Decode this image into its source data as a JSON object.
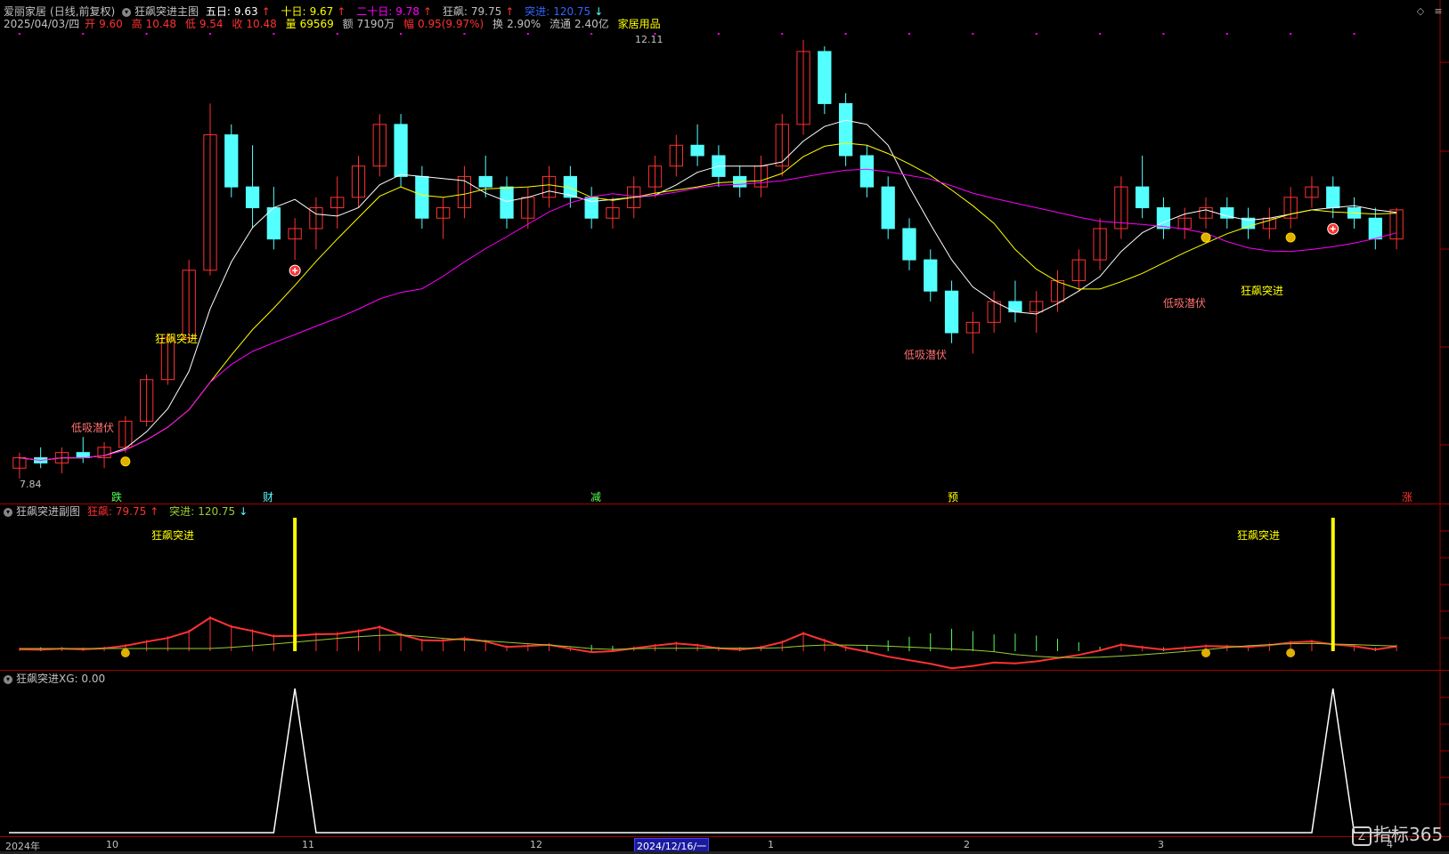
{
  "stock": {
    "name": "爱丽家居",
    "period": "(日线,前复权)",
    "indicator": "狂飙突进主图",
    "date": "2025/04/03/四",
    "open_label": "开",
    "open": "9.60",
    "high_label": "高",
    "high": "10.48",
    "low_label": "低",
    "low": "9.54",
    "close_label": "收",
    "close": "10.48",
    "vol_label": "量",
    "vol": "69569",
    "amt_label": "额",
    "amt": "7190万",
    "chg_label": "幅",
    "chg": "0.95(9.97%)",
    "turn_label": "换",
    "turn": "2.90%",
    "float_label": "流通",
    "float": "2.40亿",
    "sector": "家居用品"
  },
  "ma": {
    "ma5_label": "五日:",
    "ma5": "9.63",
    "ma10_label": "十日:",
    "ma10": "9.67",
    "ma20_label": "二十日:",
    "ma20": "9.78",
    "kb_label": "狂飙:",
    "kb": "79.75",
    "tj_label": "突进:",
    "tj": "120.75",
    "up_arrow": "↑",
    "down_arrow": "↓"
  },
  "colors": {
    "up": "#ff3232",
    "down": "#54ffff",
    "ma5": "#ffffff",
    "ma10": "#ffff00",
    "ma20": "#ff00ff",
    "grid": "#a00000",
    "signal": "#ffff00"
  },
  "annotations": {
    "high_price": "12.11",
    "low_price": "7.84",
    "signal1": "狂飙突进",
    "signal2": "狂飙突进",
    "dip1": "低吸潜伏",
    "dip2": "低吸潜伏",
    "dip3": "低吸潜伏"
  },
  "event_marks": [
    {
      "label": "跌",
      "color": "#54ff54"
    },
    {
      "label": "财",
      "color": "#54ffff"
    },
    {
      "label": "减",
      "color": "#54ff54"
    },
    {
      "label": "预",
      "color": "#ffff00"
    },
    {
      "label": "涨",
      "color": "#ff3232"
    }
  ],
  "sub1": {
    "title": "狂飙突进副图",
    "kb_label": "狂飙:",
    "kb": "79.75",
    "tj_label": "突进:",
    "tj": "120.75",
    "signal1": "狂飙突进",
    "signal2": "狂飙突进"
  },
  "sub2": {
    "title": "狂飙突进XG",
    "value": ": 0.00"
  },
  "timeline": {
    "year": "2024年",
    "months": [
      "10",
      "11",
      "12",
      "1",
      "2",
      "3",
      "4"
    ],
    "cursor_date": "2024/12/16/一"
  },
  "watermark": "指标365",
  "chart_data": {
    "type": "candlestick",
    "title": "",
    "ylim": [
      7.84,
      12.11
    ],
    "ohlc": [
      [
        8.0,
        8.15,
        7.9,
        8.1
      ],
      [
        8.1,
        8.2,
        8.0,
        8.05
      ],
      [
        8.05,
        8.2,
        7.95,
        8.15
      ],
      [
        8.15,
        8.3,
        8.05,
        8.1
      ],
      [
        8.1,
        8.25,
        8.0,
        8.2
      ],
      [
        8.2,
        8.5,
        8.15,
        8.45
      ],
      [
        8.45,
        8.9,
        8.4,
        8.85
      ],
      [
        8.85,
        9.3,
        8.8,
        9.25
      ],
      [
        9.25,
        10.0,
        9.2,
        9.9
      ],
      [
        9.9,
        11.5,
        9.85,
        11.2
      ],
      [
        11.2,
        11.3,
        10.6,
        10.7
      ],
      [
        10.7,
        11.1,
        10.3,
        10.5
      ],
      [
        10.5,
        10.7,
        10.1,
        10.2
      ],
      [
        10.2,
        10.4,
        10.0,
        10.3
      ],
      [
        10.3,
        10.6,
        10.1,
        10.5
      ],
      [
        10.5,
        10.8,
        10.3,
        10.6
      ],
      [
        10.6,
        11.0,
        10.5,
        10.9
      ],
      [
        10.9,
        11.4,
        10.8,
        11.3
      ],
      [
        11.3,
        11.4,
        10.7,
        10.8
      ],
      [
        10.8,
        10.9,
        10.3,
        10.4
      ],
      [
        10.4,
        10.6,
        10.2,
        10.5
      ],
      [
        10.5,
        10.9,
        10.4,
        10.8
      ],
      [
        10.8,
        11.0,
        10.6,
        10.7
      ],
      [
        10.7,
        10.8,
        10.3,
        10.4
      ],
      [
        10.4,
        10.7,
        10.3,
        10.6
      ],
      [
        10.6,
        10.9,
        10.5,
        10.8
      ],
      [
        10.8,
        10.9,
        10.5,
        10.6
      ],
      [
        10.6,
        10.7,
        10.3,
        10.4
      ],
      [
        10.4,
        10.6,
        10.3,
        10.5
      ],
      [
        10.5,
        10.8,
        10.4,
        10.7
      ],
      [
        10.7,
        11.0,
        10.6,
        10.9
      ],
      [
        10.9,
        11.2,
        10.8,
        11.1
      ],
      [
        11.1,
        11.3,
        10.9,
        11.0
      ],
      [
        11.0,
        11.1,
        10.7,
        10.8
      ],
      [
        10.8,
        10.9,
        10.6,
        10.7
      ],
      [
        10.7,
        11.0,
        10.6,
        10.9
      ],
      [
        10.9,
        11.4,
        10.8,
        11.3
      ],
      [
        11.3,
        12.11,
        11.2,
        12.0
      ],
      [
        12.0,
        12.05,
        11.4,
        11.5
      ],
      [
        11.5,
        11.6,
        10.9,
        11.0
      ],
      [
        11.0,
        11.1,
        10.6,
        10.7
      ],
      [
        10.7,
        10.8,
        10.2,
        10.3
      ],
      [
        10.3,
        10.4,
        9.9,
        10.0
      ],
      [
        10.0,
        10.1,
        9.6,
        9.7
      ],
      [
        9.7,
        9.8,
        9.2,
        9.3
      ],
      [
        9.3,
        9.5,
        9.1,
        9.4
      ],
      [
        9.4,
        9.7,
        9.3,
        9.6
      ],
      [
        9.6,
        9.8,
        9.4,
        9.5
      ],
      [
        9.5,
        9.7,
        9.3,
        9.6
      ],
      [
        9.6,
        9.9,
        9.5,
        9.8
      ],
      [
        9.8,
        10.1,
        9.7,
        10.0
      ],
      [
        10.0,
        10.4,
        9.9,
        10.3
      ],
      [
        10.3,
        10.8,
        10.2,
        10.7
      ],
      [
        10.7,
        11.0,
        10.4,
        10.5
      ],
      [
        10.5,
        10.6,
        10.2,
        10.3
      ],
      [
        10.3,
        10.5,
        10.2,
        10.4
      ],
      [
        10.4,
        10.6,
        10.3,
        10.5
      ],
      [
        10.5,
        10.6,
        10.3,
        10.4
      ],
      [
        10.4,
        10.5,
        10.2,
        10.3
      ],
      [
        10.3,
        10.5,
        10.2,
        10.4
      ],
      [
        10.4,
        10.7,
        10.3,
        10.6
      ],
      [
        10.6,
        10.8,
        10.5,
        10.7
      ],
      [
        10.7,
        10.8,
        10.4,
        10.5
      ],
      [
        10.5,
        10.6,
        10.3,
        10.4
      ],
      [
        10.4,
        10.5,
        10.1,
        10.2
      ],
      [
        10.2,
        10.5,
        10.1,
        10.48
      ]
    ]
  }
}
